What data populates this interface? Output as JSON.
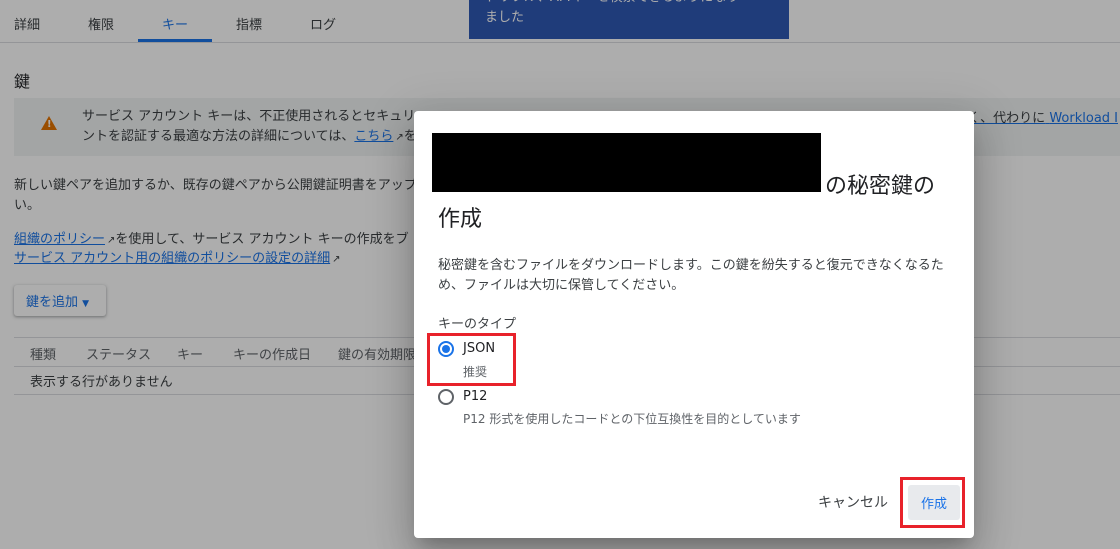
{
  "tabs": [
    "詳細",
    "権限",
    "キー",
    "指標",
    "ログ"
  ],
  "active_tab": "キー",
  "toast": {
    "line1": "ドリフル、APIキーを検索できるようになり",
    "line2": "ました"
  },
  "section_title": "鍵",
  "warning": {
    "line1": "サービス アカウント キーは、不正使用されるとセキュリ",
    "line1_end": "く、代わりに",
    "line1_link": "Workload I",
    "line2_pre": "ントを認証する最適な方法の詳細については、",
    "line2_link": "こちら",
    "line2_post": "を"
  },
  "body": {
    "para1_line1": "新しい鍵ペアを追加するか、既存の鍵ペアから公開鍵証明書をアップ",
    "para1_line2": "い。",
    "para2_link": "組織のポリシー",
    "para2_text": "を使用して、サービス アカウント キーの作成をブ",
    "para3_link": "サービス アカウント用の組織のポリシーの設定の詳細"
  },
  "add_key_button": "鍵を追加",
  "table": {
    "columns": [
      "種類",
      "ステータス",
      "キー",
      "キーの作成日",
      "鍵の有効期限"
    ],
    "empty_text": "表示する行がありません"
  },
  "dialog": {
    "title_suffix": "の秘密鍵の",
    "title_line2": "作成",
    "description": "秘密鍵を含むファイルをダウンロードします。この鍵を紛失すると復元できなくなるため、ファイルは大切に保管してください。",
    "key_type_label": "キーのタイプ",
    "options": [
      {
        "label": "JSON",
        "sublabel": "推奨",
        "checked": true
      },
      {
        "label": "P12",
        "sublabel": "P12 形式を使用したコードとの下位互換性を目的としています",
        "checked": false
      }
    ],
    "cancel_label": "キャンセル",
    "create_label": "作成"
  },
  "colors": {
    "accent": "#1a73e8",
    "toast_bg": "#2f59b4",
    "highlight": "#e8222a",
    "warning_icon": "#e37400"
  }
}
